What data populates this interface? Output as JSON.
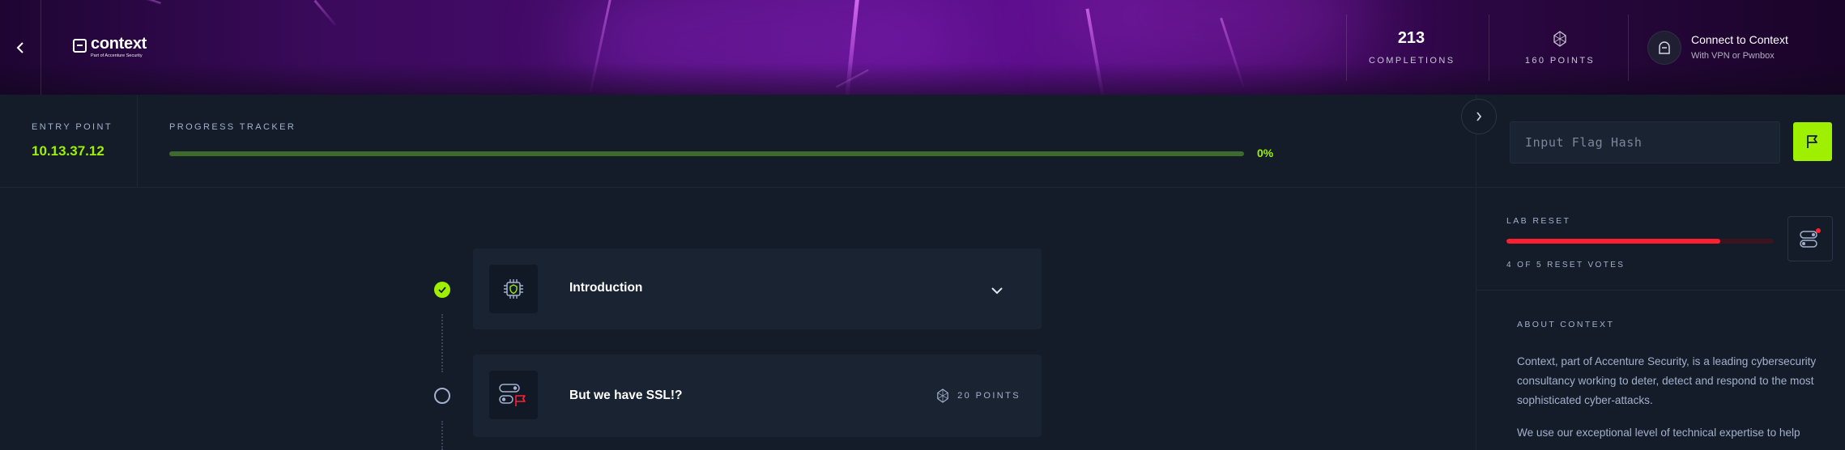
{
  "header": {
    "back_icon": "chevron-left-icon",
    "logo": {
      "name": "context",
      "tagline": "Part of Accenture Security"
    },
    "completions": {
      "value": "213",
      "label": "COMPLETIONS"
    },
    "points": {
      "label": "160 POINTS",
      "icon": "points-diamond-icon"
    },
    "connect": {
      "title": "Connect to Context",
      "subtitle": "With VPN or Pwnbox",
      "icon": "ghost-helmet-icon"
    }
  },
  "entry_point": {
    "label": "ENTRY POINT",
    "value": "10.13.37.12"
  },
  "progress": {
    "label": "PROGRESS TRACKER",
    "percent_text": "0%",
    "value": 0
  },
  "flag": {
    "placeholder": "Input Flag Hash",
    "submit_icon": "flag-icon"
  },
  "lab_reset": {
    "label": "LAB RESET",
    "votes_text": "4 OF 5 RESET VOTES",
    "votes": 4,
    "votes_needed": 5,
    "icon": "reset-toggle-icon"
  },
  "about": {
    "label": "ABOUT CONTEXT",
    "p1": "Context, part of Accenture Security, is a leading cybersecurity consultancy working to deter, detect and respond to the most sophisticated cyber-attacks.",
    "p2": "We use our exceptional level of technical expertise to help"
  },
  "tasks": [
    {
      "title": "Introduction",
      "completed": true,
      "icon": "chip-shield-icon",
      "expand_icon": "chevron-down-icon"
    },
    {
      "title": "But we have SSL!?",
      "completed": false,
      "icon": "toggle-flag-icon",
      "points": "20 POINTS"
    }
  ],
  "colors": {
    "accent": "#9fef00",
    "danger": "#ff1f2f",
    "bg": "#141b29",
    "card": "#1a2332",
    "muted": "#a4b1cd"
  }
}
